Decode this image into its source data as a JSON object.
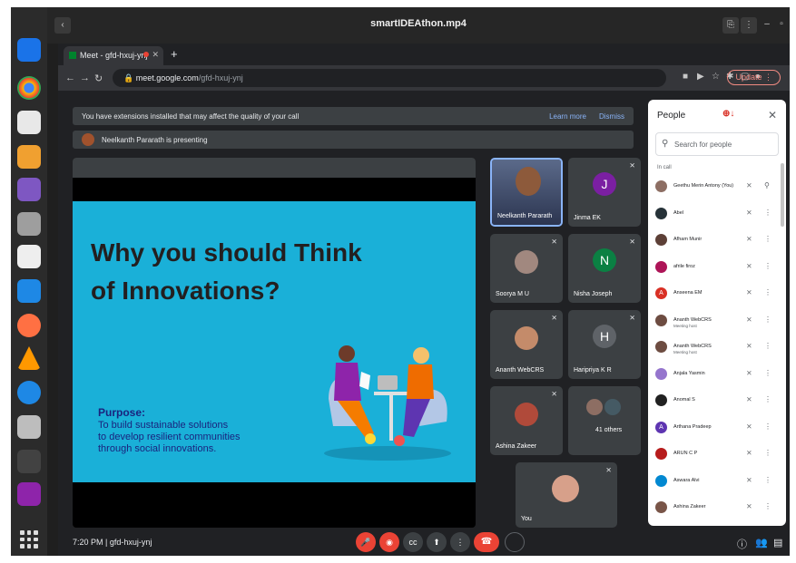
{
  "player": {
    "title": "smartIDEAthon.mp4"
  },
  "browser": {
    "tab_title": "Meet - gfd-hxuj-ynj",
    "url_domain": "meet.google.com",
    "url_path": "/gfd-hxuj-ynj",
    "update_label": "Update"
  },
  "banner": {
    "text": "You have extensions installed that may affect the quality of your call",
    "learn_more": "Learn more",
    "dismiss": "Dismiss"
  },
  "presenting": {
    "text": "Neelkanth Pararath is presenting"
  },
  "slide": {
    "heading": "Why you should Think of Innovations?",
    "purpose_title": "Purpose:",
    "purpose_line1": "To build sustainable solutions",
    "purpose_line2": "to develop resilient communities",
    "purpose_line3": "through social innovations."
  },
  "tiles": [
    {
      "name": "Neelkanth Pararath"
    },
    {
      "name": "Jinma EK",
      "initial": "J",
      "color": "#7b1fa2"
    },
    {
      "name": "Soorya M U"
    },
    {
      "name": "Nisha Joseph",
      "initial": "N",
      "color": "#0b8043"
    },
    {
      "name": "Ananth WebCRS"
    },
    {
      "name": "Haripriya K R",
      "initial": "H",
      "color": "#5f6368"
    },
    {
      "name": "Ashina Zakeer"
    },
    {
      "name": "41 others"
    },
    {
      "name": "You"
    }
  ],
  "bottom": {
    "time_code": "7:20 PM  |  gfd-hxuj-ynj"
  },
  "people_panel": {
    "title": "People",
    "search_placeholder": "Search for people",
    "section_label": "In call",
    "participants": [
      {
        "name": "Geethu Merin Antony (You)",
        "initial": "",
        "color": "#8d6e63"
      },
      {
        "name": "Abel",
        "initial": "",
        "color": "#263238"
      },
      {
        "name": "Afham Munir",
        "initial": "",
        "color": "#5d4037"
      },
      {
        "name": "afrile firoz",
        "initial": "",
        "color": "#ad1457"
      },
      {
        "name": "Anseena EM",
        "initial": "A",
        "color": "#d93025"
      },
      {
        "name": "Ananth WebCRS",
        "sub": "Meeting host",
        "initial": "",
        "color": "#6d4c41"
      },
      {
        "name": "Ananth WebCRS",
        "sub": "Meeting host",
        "initial": "",
        "color": "#6d4c41"
      },
      {
        "name": "Anjala Yasmin",
        "initial": "",
        "color": "#9575cd"
      },
      {
        "name": "Anomal S",
        "initial": "",
        "color": "#212121"
      },
      {
        "name": "Arthana Pradeep",
        "initial": "A",
        "color": "#5e35b1"
      },
      {
        "name": "ARUN C P",
        "initial": "",
        "color": "#b71c1c"
      },
      {
        "name": "Aswara Alvi",
        "initial": "",
        "color": "#0288d1"
      },
      {
        "name": "Ashina Zakeer",
        "initial": "",
        "color": "#795548"
      }
    ]
  }
}
